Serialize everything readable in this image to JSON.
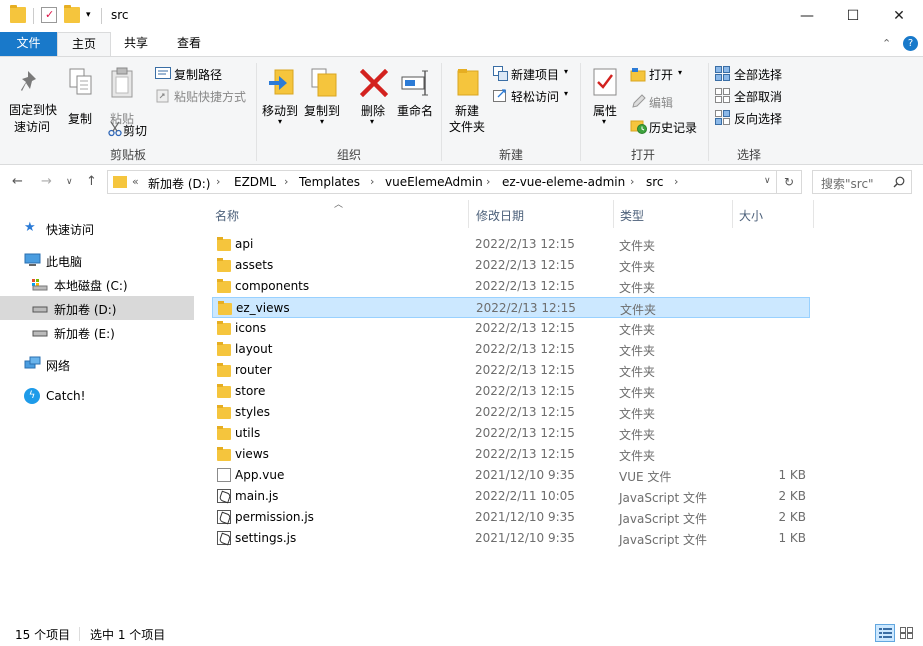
{
  "window": {
    "title": "src",
    "minimize": "—",
    "maximize": "☐",
    "close": "✕"
  },
  "ribbon_tabs": [
    "文件",
    "主页",
    "共享",
    "查看"
  ],
  "ribbon": {
    "clipboard": {
      "group_label": "剪贴板",
      "pin_line1": "固定到快",
      "pin_line2": "速访问",
      "copy": "复制",
      "paste": "粘贴",
      "copy_path": "复制路径",
      "paste_shortcut": "粘贴快捷方式",
      "cut": "剪切"
    },
    "organize": {
      "group_label": "组织",
      "move_to": "移动到",
      "copy_to": "复制到",
      "delete": "删除",
      "rename": "重命名"
    },
    "new": {
      "group_label": "新建",
      "new_folder_line1": "新建",
      "new_folder_line2": "文件夹",
      "new_item": "新建项目",
      "easy_access": "轻松访问"
    },
    "open": {
      "group_label": "打开",
      "properties": "属性",
      "open": "打开",
      "edit": "编辑",
      "history": "历史记录"
    },
    "select": {
      "group_label": "选择",
      "select_all": "全部选择",
      "select_none": "全部取消",
      "invert": "反向选择"
    }
  },
  "address": {
    "overflow": "«",
    "crumbs": [
      "新加卷 (D:)",
      "EZDML",
      "Templates",
      "vueElemeAdmin",
      "ez-vue-eleme-admin",
      "src"
    ],
    "search_placeholder": "搜索\"src\""
  },
  "nav_pane": {
    "quick_access": "快速访问",
    "this_pc": "此电脑",
    "local_disk_c": "本地磁盘 (C:)",
    "volume_d": "新加卷 (D:)",
    "volume_e": "新加卷 (E:)",
    "network": "网络",
    "catch": "Catch!"
  },
  "columns": {
    "name": "名称",
    "modified": "修改日期",
    "type": "类型",
    "size": "大小"
  },
  "files": [
    {
      "name": "api",
      "date": "2022/2/13 12:15",
      "type": "文件夹",
      "size": "",
      "icon": "folder"
    },
    {
      "name": "assets",
      "date": "2022/2/13 12:15",
      "type": "文件夹",
      "size": "",
      "icon": "folder"
    },
    {
      "name": "components",
      "date": "2022/2/13 12:15",
      "type": "文件夹",
      "size": "",
      "icon": "folder"
    },
    {
      "name": "ez_views",
      "date": "2022/2/13 12:15",
      "type": "文件夹",
      "size": "",
      "icon": "folder"
    },
    {
      "name": "icons",
      "date": "2022/2/13 12:15",
      "type": "文件夹",
      "size": "",
      "icon": "folder"
    },
    {
      "name": "layout",
      "date": "2022/2/13 12:15",
      "type": "文件夹",
      "size": "",
      "icon": "folder"
    },
    {
      "name": "router",
      "date": "2022/2/13 12:15",
      "type": "文件夹",
      "size": "",
      "icon": "folder"
    },
    {
      "name": "store",
      "date": "2022/2/13 12:15",
      "type": "文件夹",
      "size": "",
      "icon": "folder"
    },
    {
      "name": "styles",
      "date": "2022/2/13 12:15",
      "type": "文件夹",
      "size": "",
      "icon": "folder"
    },
    {
      "name": "utils",
      "date": "2022/2/13 12:15",
      "type": "文件夹",
      "size": "",
      "icon": "folder"
    },
    {
      "name": "views",
      "date": "2022/2/13 12:15",
      "type": "文件夹",
      "size": "",
      "icon": "folder"
    },
    {
      "name": "App.vue",
      "date": "2021/12/10 9:35",
      "type": "VUE 文件",
      "size": "1 KB",
      "icon": "doc"
    },
    {
      "name": "main.js",
      "date": "2022/2/11 10:05",
      "type": "JavaScript 文件",
      "size": "2 KB",
      "icon": "js"
    },
    {
      "name": "permission.js",
      "date": "2021/12/10 9:35",
      "type": "JavaScript 文件",
      "size": "2 KB",
      "icon": "js"
    },
    {
      "name": "settings.js",
      "date": "2021/12/10 9:35",
      "type": "JavaScript 文件",
      "size": "1 KB",
      "icon": "js"
    }
  ],
  "status": {
    "count": "15 个项目",
    "selected": "选中 1 个项目"
  },
  "colors": {
    "file_tab": "#1979ca",
    "selection": "#cce8ff",
    "folder": "#f5c53d"
  }
}
